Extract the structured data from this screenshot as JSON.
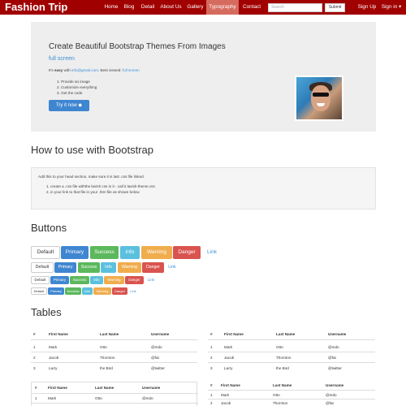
{
  "navbar": {
    "brand": "Fashion Trip",
    "items": [
      {
        "label": "Home",
        "active": false
      },
      {
        "label": "Blog",
        "active": false
      },
      {
        "label": "Detail",
        "active": false
      },
      {
        "label": "About Us",
        "active": false
      },
      {
        "label": "Gallery",
        "active": false
      },
      {
        "label": "Typography",
        "active": true
      },
      {
        "label": "Contact",
        "active": false
      }
    ],
    "search_placeholder": "Search",
    "submit_label": "Submit",
    "signup_label": "Sign Up",
    "signin_label": "Sign in ▾"
  },
  "jumbotron": {
    "title": "Create Beautiful Bootstrap Themes From Images",
    "subtitle": "full screen",
    "text_prefix": "It's ",
    "text_easy": "easy",
    "text_with": " with ",
    "email": "info@gmail.com",
    "text_best": ". Best viewed: ",
    "best_viewed": "full screen",
    "steps": [
      "Provide an image",
      "Customize everything",
      "Get the code"
    ],
    "button_label": "Try it now ◆"
  },
  "how_to": {
    "heading": "How to use with Bootstrap",
    "intro": "Add this to your head section, make sure it is last .css file linked.",
    "steps": [
      "create a .css file withthe lavish css in it - call it lavish-theme.css",
      "in your link to that file in your .htm file as shown below"
    ]
  },
  "buttons": {
    "heading": "Buttons",
    "labels": [
      "Default",
      "Primary",
      "Success",
      "Info",
      "Warning",
      "Danger",
      "Link"
    ]
  },
  "tables": {
    "heading": "Tables",
    "columns": [
      "#",
      "First Name",
      "Last Name",
      "Username"
    ],
    "rows": [
      [
        "1",
        "Mark",
        "Otto",
        "@mdo"
      ],
      [
        "2",
        "Jacob",
        "Thornton",
        "@fat"
      ],
      [
        "3",
        "Larry",
        "the Bird",
        "@twitter"
      ]
    ]
  }
}
